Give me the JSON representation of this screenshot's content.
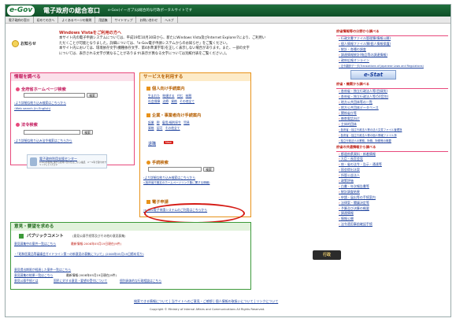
{
  "header": {
    "logo": "e-Gov",
    "title": "電子政府の総合窓口",
    "tagline": "e-Gov(イーガブ)は総合的な行政ポータルサイトです"
  },
  "nav": [
    "電子政府の窓口",
    "初めての方へ",
    "よくあるページの質問",
    "用語集",
    "サイトマップ",
    "お問い合わせ",
    "ヘルプ"
  ],
  "notice": {
    "label": "お知らせ",
    "heading": "Windows Vistaをご利用の方へ",
    "lines": [
      "本サイト内の電子申請システムについては、平成19年10月30日から、新たにWindows Vista及びInternet Explorer7により、ご利用い",
      "ただくことが可能となりました。詳細については、「e-Gov電子申請システムからのお知らせ」をご覧ください。",
      "本サイト内においては、環境依存文字(機種依存文字、第4水準漢字等)を正しく表示しない場合があります。また、一部の文字",
      "については、表示される文字が異なることがあります(表示が異なる文字については別紙付表をご覧ください。)。"
    ]
  },
  "left": {
    "info_search": "情報を調べる",
    "ministry_title": "全府省ホームページ検索",
    "search_btn": "検索",
    "adv_links": [
      "›より詳細な絞り込み検索はこちらから",
      "›Web search (in English)"
    ],
    "law_title": "法令検索",
    "law_adv": "›より詳細な絞り込み法令検索はこちらから",
    "mail_box": "電子政府利用支援センター",
    "mail_sub": "e-Govの利用に関するお問い合わせはこちら(電話、メール等で受付)をクリックしてください"
  },
  "service": {
    "title": "サービスを利用する",
    "personal_title": "個人向け手続案内",
    "personal_rows": [
      [
        "生まれた",
        "結婚する",
        "住む",
        "納税"
      ],
      [
        "社会保障",
        "治療",
        "資格",
        "その他全て"
      ]
    ],
    "corp_title": "企業・事業者向け手続案内",
    "corp_rows": [
      [
        "起業",
        "税",
        "雇用/福利厚生",
        "貿易"
      ],
      [
        "資格",
        "認可",
        "その他全て"
      ]
    ],
    "retire": "退職",
    "new_badge": "New",
    "proc_title": "手続検索",
    "search_btn": "検索",
    "proc_links": [
      "›より詳細な絞り込み検索はこちらから",
      "›(各府省庁固定のホームページリンク集に関する情報)"
    ],
    "esub_title": "電子申請",
    "esub_link": "›e-Gov電子申請システムのご利用はこちらから"
  },
  "opinion": {
    "title": "意見・要望を求める",
    "pc_title": "パブリックコメント",
    "pc_sub": "(意見公募手続等及びその他の意見募集)",
    "pc_line1": "意見募集中の案件一覧はこちら",
    "pc_line1b": "最新情報:2008年05月19日現在(9件)",
    "pc_line2": "・「昭和医薬品等審議会ガイドライン第一の新意見の募集について」(2008年05月19日締め切り)",
    "pc_more": [
      "意見提出期限が経過した案件一覧はこちら",
      "意見募集の結果一覧はこちら",
      "意見公募手続とは"
    ],
    "pc_more_b": [
      "最新情報:2008年05月19日現在(9件)",
      "国民に対する意見・要望の受付について",
      "個別具体的な行政相談はこちら"
    ]
  },
  "right": {
    "sec1": "府省情報等の分野から調べる",
    "sec1_items": [
      "行政文書ファイル管理簿(情報公開)",
      "個人情報ファイル簿(個人情報保護)",
      "統計・各種の調査",
      "調達情報統計(物品等の調達情報)",
      "政府広報オンライン",
      "法令翻訳データ(Translations of Japanese Laws and Regulations)"
    ],
    "estat": "e-Stat",
    "sec2": "府省・機関から調べる",
    "sec2_items": [
      "各府省・独立行政法人等(目録別)",
      "各府省・独立行政法人等(50音別)",
      "地方公共団体等の一覧",
      "地方公共団体データベース",
      "関係省庁等",
      "携帯電話向け",
      "主体的団体",
      "各府省・独立行政法人等の法人文書ファイル管理簿",
      "各府省・独立行政法人等の個人情報ファイル簿",
      "独立行政法人の業務、財務、財務等の概要"
    ],
    "sec3": "府省の共通情報から調べる",
    "sec3_items": [
      "都道府県資料・新着情報",
      "大臣・長官会見",
      "府・省の法令・告示・通達等",
      "国会提出法案",
      "所管公益法人",
      "政策評価",
      "白書・年次報告書等",
      "統計調査結果",
      "申請・届出等の手続案内",
      "法律案・閣議決定等",
      "予算及び決算の概要",
      "調達情報",
      "情報公開",
      "法令適用事前確認手続"
    ],
    "badge": "行政"
  },
  "footer": {
    "links": "検索できる情報について | 当サイトへのご意見・ご感想 | 個人情報の取扱いについて | リンクについて",
    "copyright": "Copyright © Ministry of Internal Affairs and Communications All Rights Reserved."
  },
  "colors": {
    "header": "#1a6a37",
    "pink": "#e8497c",
    "orange": "#e8921a",
    "green": "#3d9a3a",
    "annotation": "#d51a14"
  }
}
